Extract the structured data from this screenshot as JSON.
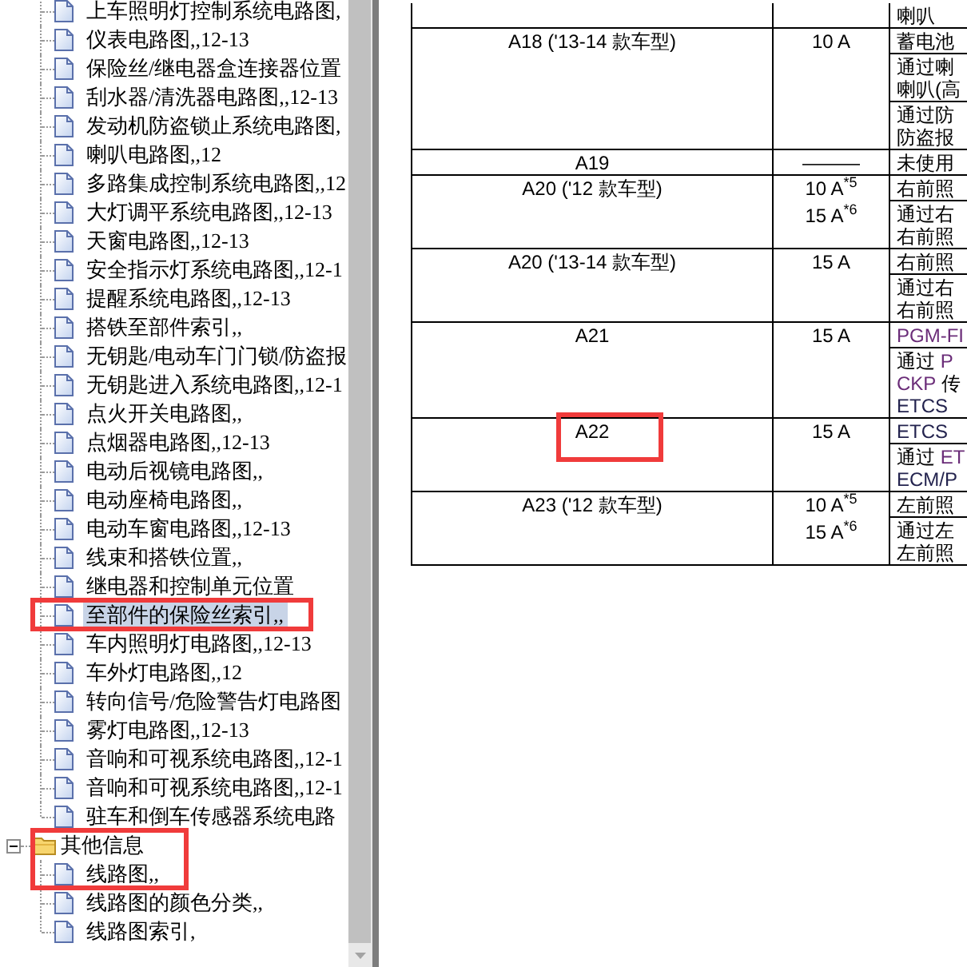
{
  "tree": [
    {
      "kind": "folder",
      "expanded": true,
      "children": [
        {
          "kind": "page",
          "label": "上车照明灯控制系统电路图,",
          "selected": false,
          "marked": false
        },
        {
          "kind": "page",
          "label": "仪表电路图,,12-13",
          "selected": false,
          "marked": false
        },
        {
          "kind": "page",
          "label": "保险丝/继电器盒连接器位置",
          "selected": false,
          "marked": false
        },
        {
          "kind": "page",
          "label": "刮水器/清洗器电路图,,12-13",
          "selected": false,
          "marked": false
        },
        {
          "kind": "page",
          "label": "发动机防盗锁止系统电路图,",
          "selected": false,
          "marked": false
        },
        {
          "kind": "page",
          "label": "喇叭电路图,,12",
          "selected": false,
          "marked": false
        },
        {
          "kind": "page",
          "label": "多路集成控制系统电路图,,12",
          "selected": false,
          "marked": false
        },
        {
          "kind": "page",
          "label": "大灯调平系统电路图,,12-13",
          "selected": false,
          "marked": false
        },
        {
          "kind": "page",
          "label": "天窗电路图,,12-13",
          "selected": false,
          "marked": false
        },
        {
          "kind": "page",
          "label": "安全指示灯系统电路图,,12-1",
          "selected": false,
          "marked": false
        },
        {
          "kind": "page",
          "label": "提醒系统电路图,,12-13",
          "selected": false,
          "marked": false
        },
        {
          "kind": "page",
          "label": "搭铁至部件索引,,",
          "selected": false,
          "marked": false
        },
        {
          "kind": "page",
          "label": "无钥匙/电动车门门锁/防盗报",
          "selected": false,
          "marked": false
        },
        {
          "kind": "page",
          "label": "无钥匙进入系统电路图,,12-1",
          "selected": false,
          "marked": false
        },
        {
          "kind": "page",
          "label": "点火开关电路图,,",
          "selected": false,
          "marked": false
        },
        {
          "kind": "page",
          "label": "点烟器电路图,,12-13",
          "selected": false,
          "marked": false
        },
        {
          "kind": "page",
          "label": "电动后视镜电路图,,",
          "selected": false,
          "marked": false
        },
        {
          "kind": "page",
          "label": "电动座椅电路图,,",
          "selected": false,
          "marked": false
        },
        {
          "kind": "page",
          "label": "电动车窗电路图,,12-13",
          "selected": false,
          "marked": false
        },
        {
          "kind": "page",
          "label": "线束和搭铁位置,,",
          "selected": false,
          "marked": false
        },
        {
          "kind": "page",
          "label": "继电器和控制单元位置",
          "selected": false,
          "marked": false
        },
        {
          "kind": "page",
          "label": "至部件的保险丝索引,,",
          "selected": true,
          "marked": true
        },
        {
          "kind": "page",
          "label": "车内照明灯电路图,,12-13",
          "selected": false,
          "marked": false
        },
        {
          "kind": "page",
          "label": "车外灯电路图,,12",
          "selected": false,
          "marked": false
        },
        {
          "kind": "page",
          "label": "转向信号/危险警告灯电路图",
          "selected": false,
          "marked": false
        },
        {
          "kind": "page",
          "label": "雾灯电路图,,12-13",
          "selected": false,
          "marked": false
        },
        {
          "kind": "page",
          "label": "音响和可视系统电路图,,12-1",
          "selected": false,
          "marked": false
        },
        {
          "kind": "page",
          "label": "音响和可视系统电路图,,12-1",
          "selected": false,
          "marked": false
        },
        {
          "kind": "page",
          "label": "驻车和倒车传感器系统电路",
          "selected": false,
          "marked": false
        }
      ]
    },
    {
      "kind": "folder",
      "label": "其他信息",
      "expanded": true,
      "selected": false,
      "marked": true,
      "children": [
        {
          "kind": "page",
          "label": "线路图,,",
          "selected": false,
          "marked": true
        },
        {
          "kind": "page",
          "label": "线路图的颜色分类,,",
          "selected": false,
          "marked": false
        },
        {
          "kind": "page",
          "label": "线路图索引,",
          "selected": false,
          "marked": false
        }
      ]
    }
  ],
  "fuse_table": {
    "rows": [
      {
        "circuits": [
          {
            "lines": [
              "喇叭"
            ]
          }
        ]
      },
      {
        "fuse": "A18 ('13-14 款车型)",
        "marked": false,
        "ratings": [
          "10 A"
        ],
        "circuits": [
          {
            "lines": [
              "蓄电池"
            ]
          },
          {
            "lines": [
              "通过喇",
              "喇叭(高"
            ]
          },
          {
            "lines": [
              "通过防",
              "防盗报"
            ]
          }
        ]
      },
      {
        "fuse": "A19",
        "marked": false,
        "ratings": [
          "———"
        ],
        "circuits": [
          {
            "lines": [
              "未使用"
            ]
          }
        ]
      },
      {
        "fuse": "A20 ('12 款车型)",
        "marked": false,
        "ratings": [
          "10 A$^{*5}$",
          "15 A$^{*6}$"
        ],
        "circuits": [
          {
            "lines": [
              "右前照"
            ]
          },
          {
            "lines": [
              "通过右",
              "右前照"
            ]
          }
        ]
      },
      {
        "fuse": "A20 ('13-14 款车型)",
        "marked": false,
        "ratings": [
          "15 A"
        ],
        "circuits": [
          {
            "lines": [
              "右前照"
            ]
          },
          {
            "lines": [
              "通过右",
              "右前照"
            ]
          }
        ]
      },
      {
        "fuse": "A21",
        "marked": false,
        "ratings": [
          "15 A"
        ],
        "circuits": [
          {
            "lines": [
              [
                {
                  "text": "PGM-FI",
                  "kind": "visited"
                }
              ]
            ]
          },
          {
            "lines": [
              [
                {
                  "text": "通过 ",
                  "kind": "text"
                },
                {
                  "text": "P",
                  "kind": "visited"
                }
              ],
              [
                {
                  "text": "CKP",
                  "kind": "visited"
                },
                {
                  "text": " 传",
                  "kind": "text"
                }
              ],
              [
                {
                  "text": "ETCS",
                  "kind": "link"
                }
              ]
            ]
          }
        ]
      },
      {
        "fuse": "A22",
        "marked": true,
        "ratings": [
          "15 A"
        ],
        "circuits": [
          {
            "lines": [
              [
                {
                  "text": "ETCS",
                  "kind": "link"
                }
              ]
            ]
          },
          {
            "lines": [
              [
                {
                  "text": "通过 ",
                  "kind": "text"
                },
                {
                  "text": "ET",
                  "kind": "visited"
                }
              ],
              [
                {
                  "text": "ECM/P",
                  "kind": "link"
                }
              ]
            ]
          }
        ]
      },
      {
        "fuse": "A23 ('12 款车型)",
        "marked": false,
        "ratings": [
          "10 A$^{*5}$",
          "15 A$^{*6}$"
        ],
        "circuits": [
          {
            "lines": [
              "左前照"
            ]
          },
          {
            "lines": [
              "通过左",
              "左前照"
            ]
          }
        ]
      }
    ]
  }
}
